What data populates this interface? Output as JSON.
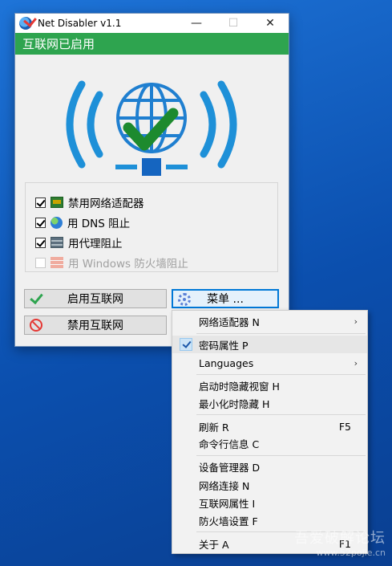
{
  "window": {
    "title": "Net Disabler v1.1",
    "minimize": "—",
    "maximize": "☐",
    "close": "✕",
    "status": "互联网已启用",
    "status_color": "#2ea44f",
    "illustration_icon": "wifi-globe-check-icon"
  },
  "options": [
    {
      "label": "禁用网络适配器",
      "checked": true,
      "enabled": true,
      "icon": "network-card-icon"
    },
    {
      "label": "用 DNS 阻止",
      "checked": true,
      "enabled": true,
      "icon": "globe-icon"
    },
    {
      "label": "用代理阻止",
      "checked": true,
      "enabled": true,
      "icon": "proxy-server-icon"
    },
    {
      "label": "用 Windows 防火墙阻止",
      "checked": false,
      "enabled": false,
      "icon": "firewall-icon"
    }
  ],
  "buttons": {
    "enable": "启用互联网",
    "menu": "菜单 ...",
    "disable": "禁用互联网"
  },
  "menu": {
    "items": [
      {
        "label": "网络适配器 N",
        "submenu": true
      },
      {
        "label": "密码属性 P",
        "checked": true
      },
      {
        "label": "Languages",
        "submenu": true
      },
      {
        "label": "启动时隐藏视窗 H"
      },
      {
        "label": "最小化时隐藏 H"
      },
      {
        "label": "刷新 R",
        "shortcut": "F5"
      },
      {
        "label": "命令行信息 C"
      },
      {
        "label": "设备管理器 D"
      },
      {
        "label": "网络连接 N"
      },
      {
        "label": "互联网属性 I"
      },
      {
        "label": "防火墙设置 F"
      },
      {
        "label": "关于 A",
        "shortcut": "F1"
      }
    ],
    "submenu_arrow": "›"
  },
  "watermark": {
    "line1": "吾爱破解论坛",
    "line2": "www.52pojie.cn"
  }
}
